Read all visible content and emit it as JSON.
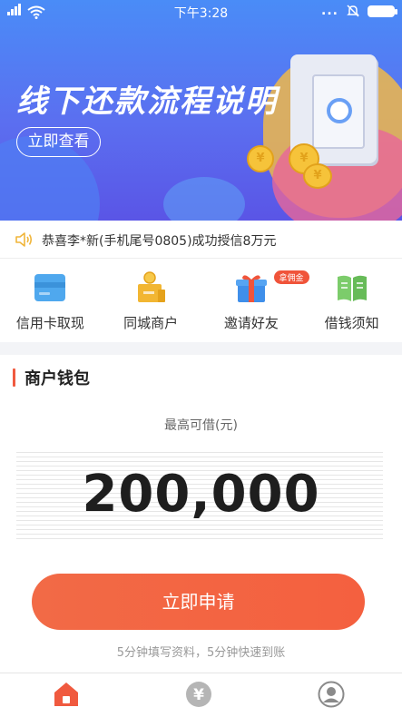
{
  "status_bar": {
    "time": "下午3:28",
    "dots": "...",
    "battery_level": 1.0
  },
  "banner": {
    "title": "线下还款流程说明",
    "button_label": "立即查看",
    "coin_symbol": "¥",
    "colors": {
      "top": "#4a8cf7",
      "bottom": "#5a55e6"
    }
  },
  "notice": {
    "text": "恭喜李*新(手机尾号0805)成功授信8万元",
    "icon": "speaker-icon"
  },
  "actions": [
    {
      "label": "信用卡取现",
      "icon": "credit-card-icon"
    },
    {
      "label": "同城商户",
      "icon": "merchant-icon"
    },
    {
      "label": "邀请好友",
      "icon": "gift-icon",
      "badge": "拿佣金"
    },
    {
      "label": "借钱须知",
      "icon": "book-icon"
    }
  ],
  "wallet": {
    "title": "商户钱包",
    "limit_label": "最高可借(元)",
    "limit_value": "200,000",
    "apply_label": "立即申请",
    "apply_sub": "5分钟填写资料，5分钟快速到账"
  },
  "tabbar": {
    "items": [
      {
        "icon": "home-icon",
        "active": true
      },
      {
        "icon": "yen-icon",
        "symbol": "¥",
        "active": false
      },
      {
        "icon": "user-icon",
        "active": false
      }
    ]
  },
  "colors": {
    "accent": "#f2603f",
    "text_dark": "#222222",
    "text_muted": "#999999"
  }
}
